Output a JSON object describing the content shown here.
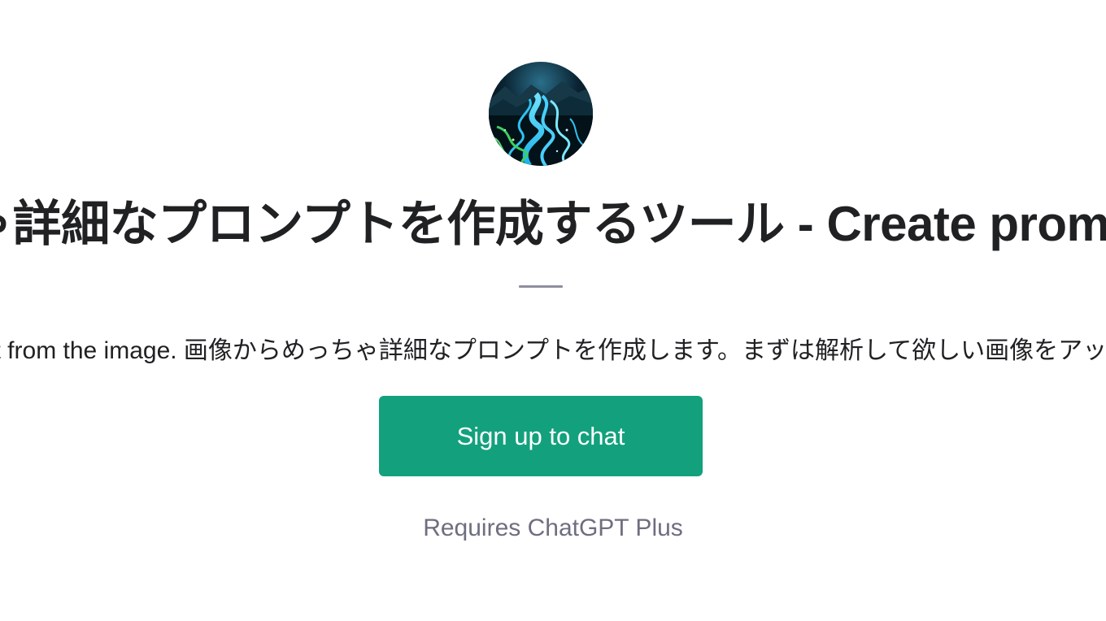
{
  "gpt": {
    "avatar_icon": "abstract-landscape-avatar-icon",
    "title": "画像からめっちゃ詳細なプロンプトを作成するツール - Create prompts from images",
    "description": "Create a detailed prompt from the image. 画像からめっちゃ詳細なプロンプトを作成します。まずは解析して欲しい画像をアップロードしてください。"
  },
  "actions": {
    "signup_label": "Sign up to chat"
  },
  "footer": {
    "requires_label": "Requires ChatGPT Plus"
  },
  "colors": {
    "button_bg": "#13a17d",
    "title_text": "#202123",
    "muted_text": "#6e6e80",
    "divider": "#8e8ea0"
  }
}
